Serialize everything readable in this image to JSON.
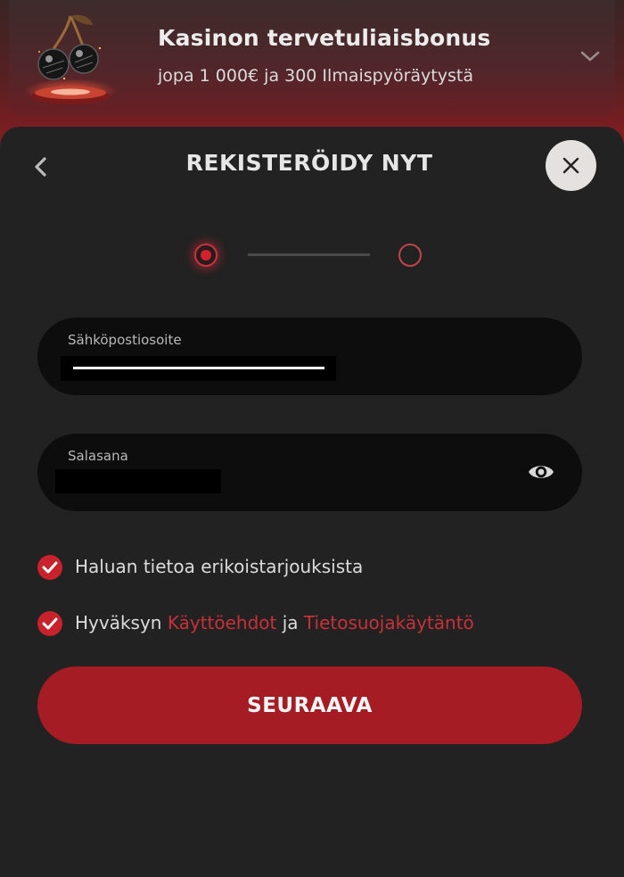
{
  "banner": {
    "title": "Kasinon tervetuliaisbonus",
    "subtitle": "jopa 1 000€ ja 300 Ilmaispyöräytystä",
    "art_icon": "cherries-on-pedestal-icon",
    "expand_icon": "chevron-down-icon"
  },
  "modal": {
    "title": "REKISTERÖIDY NYT",
    "back_icon": "chevron-left-icon",
    "close_icon": "close-icon",
    "steps": {
      "current": 1,
      "total": 2
    }
  },
  "form": {
    "email": {
      "label": "Sähköpostiosoite",
      "value": ""
    },
    "password": {
      "label": "Salasana",
      "value": "",
      "toggle_icon": "eye-icon"
    },
    "offers": {
      "checked": true,
      "label": "Haluan tietoa erikoistarjouksista"
    },
    "terms": {
      "checked": true,
      "prefix": "Hyväksyn",
      "terms_link": "Käyttöehdot",
      "conjunction": "ja",
      "privacy_link": "Tietosuojakäytäntö"
    },
    "submit_label": "SEURAAVA"
  },
  "colors": {
    "accent": "#c8222c",
    "button": "#a51c24",
    "modal_bg": "#222222",
    "field_bg": "#0d0d0d",
    "banner_bg": "#51262a"
  }
}
